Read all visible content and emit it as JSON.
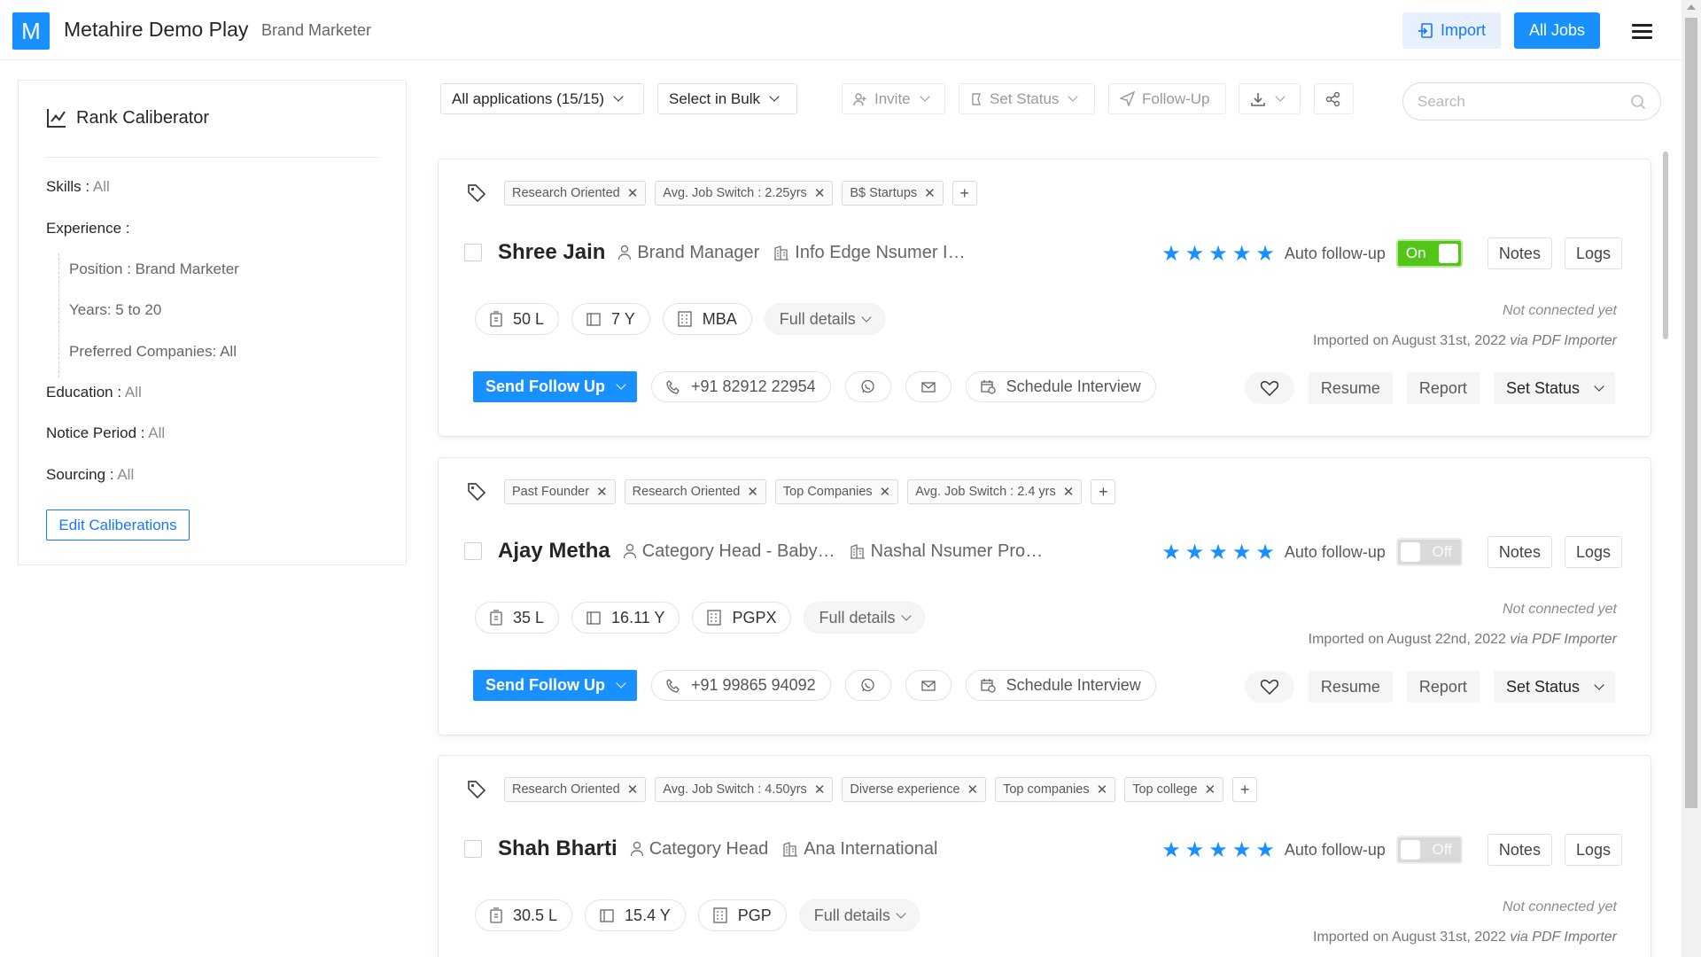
{
  "header": {
    "logo_letter": "M",
    "app_title": "Metahire Demo Play",
    "app_subtitle": "Brand Marketer",
    "import_label": "Import",
    "all_jobs_label": "All Jobs",
    "menu_icon": "hamburger-icon"
  },
  "sidebar": {
    "title": "Rank Caliberator",
    "skills_label": "Skills : ",
    "skills_value": "All",
    "experience_label": "Experience :",
    "position_label": "Position : Brand Marketer",
    "years_label": "Years: 5 to 20",
    "preferred_label": "Preferred Companies: All",
    "education_label": "Education : ",
    "education_value": "All",
    "notice_label": "Notice Period : ",
    "notice_value": "All",
    "sourcing_label": "Sourcing : ",
    "sourcing_value": "All",
    "edit_button": "Edit Caliberations"
  },
  "toolbar": {
    "all_applications": "All applications (15/15)",
    "select_bulk": "Select in Bulk",
    "invite": "Invite",
    "set_status": "Set Status",
    "follow_up": "Follow-Up",
    "search_placeholder": "Search"
  },
  "common": {
    "auto_followup": "Auto follow-up",
    "notes": "Notes",
    "logs": "Logs",
    "full_details": "Full details",
    "send_followup": "Send Follow Up",
    "schedule_interview": "Schedule Interview",
    "resume": "Resume",
    "report": "Report",
    "set_status": "Set Status",
    "not_connected": "Not connected yet",
    "via": "via PDF Importer",
    "star_color": "#1890ff",
    "accent": "#1890ff",
    "toggle_on_color": "#52c41a"
  },
  "candidates": [
    {
      "name": "Shree Jain",
      "role": "Brand Manager",
      "company": "Info Edge Nsumer I…",
      "tags": [
        "Research Oriented",
        "Avg. Job Switch : 2.25yrs",
        "B$ Startups"
      ],
      "rating": 5,
      "auto_followup": "On",
      "salary": "50 L",
      "experience": "7 Y",
      "degree": "MBA",
      "phone": "+91 82912 22954",
      "imported": "Imported on August 31st, 2022 "
    },
    {
      "name": "Ajay Metha",
      "role": "Category Head - Baby…",
      "company": "Nashal Nsumer Pro…",
      "tags": [
        "Past Founder",
        "Research Oriented",
        "Top Companies",
        "Avg. Job Switch : 2.4 yrs"
      ],
      "rating": 5,
      "auto_followup": "Off",
      "salary": "35 L",
      "experience": "16.11 Y",
      "degree": "PGPX",
      "phone": "+91 99865 94092",
      "imported": "Imported on August 22nd, 2022 "
    },
    {
      "name": "Shah Bharti",
      "role": "Category Head",
      "company": "Ana International",
      "tags": [
        "Research Oriented",
        "Avg. Job Switch : 4.50yrs",
        "Diverse experience",
        "Top companies",
        "Top college"
      ],
      "rating": 5,
      "auto_followup": "Off",
      "salary": "30.5 L",
      "experience": "15.4 Y",
      "degree": "PGP",
      "imported": "Imported on August 31st, 2022 "
    }
  ]
}
